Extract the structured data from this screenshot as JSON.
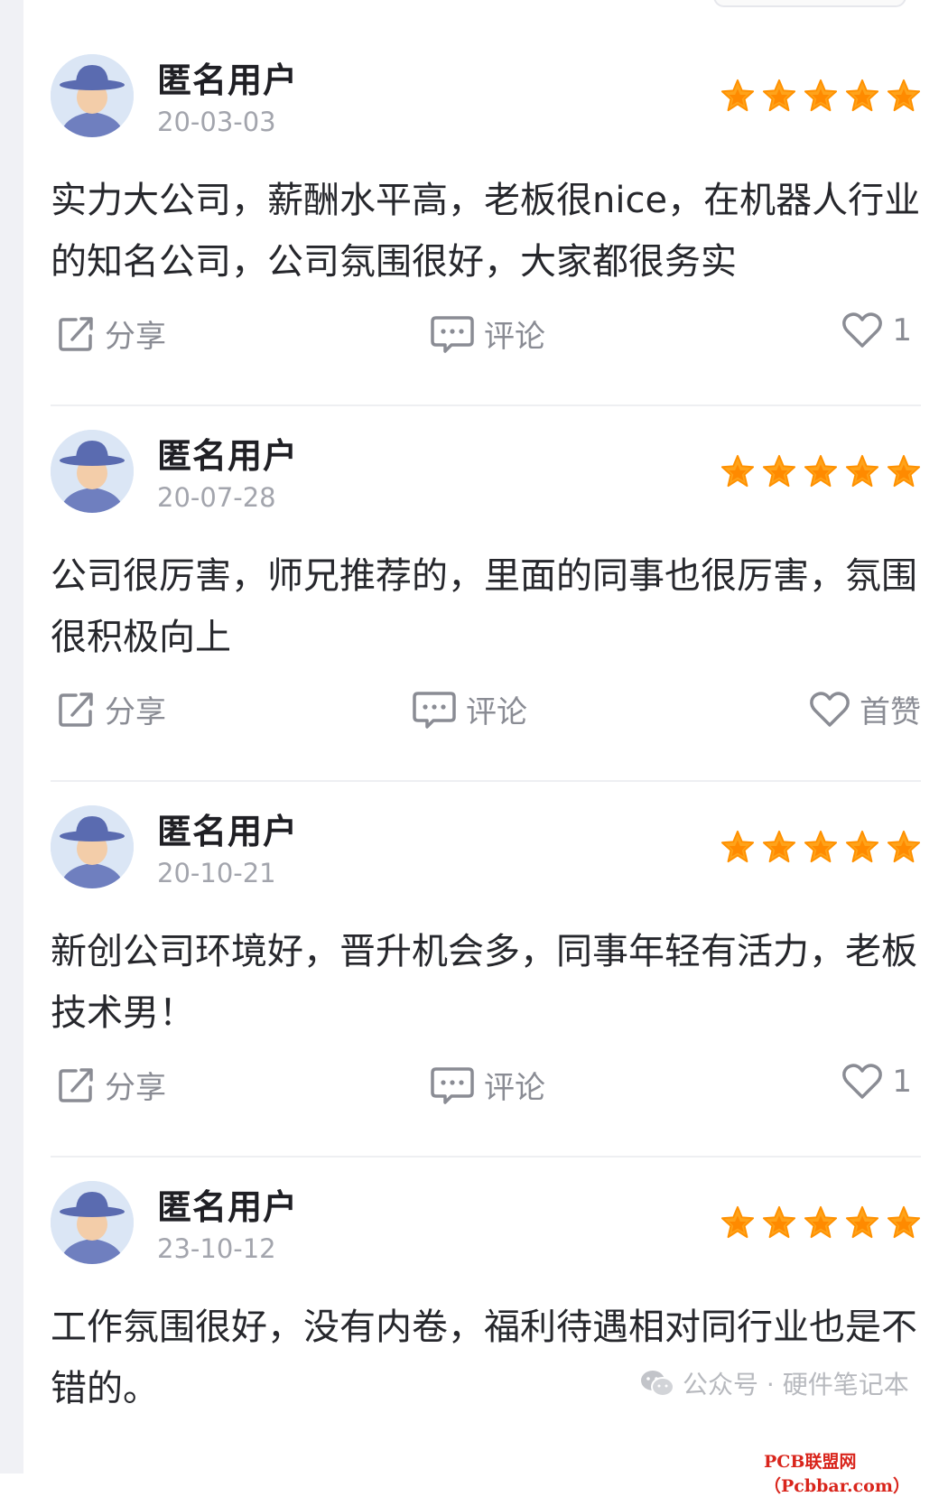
{
  "reviews": [
    {
      "user": "匿名用户",
      "date": "20-03-03",
      "rating": 5,
      "text": "实力大公司，薪酬水平高，老板很nice，在机器人行业的知名公司，公司氛围很好，大家都很务实",
      "share_label": "分享",
      "comment_label": "评论",
      "like_label": "1"
    },
    {
      "user": "匿名用户",
      "date": "20-07-28",
      "rating": 5,
      "text": "公司很厉害，师兄推荐的，里面的同事也很厉害，氛围很积极向上",
      "share_label": "分享",
      "comment_label": "评论",
      "like_label": "首赞"
    },
    {
      "user": "匿名用户",
      "date": "20-10-21",
      "rating": 5,
      "text": "新创公司环境好，晋升机会多，同事年轻有活力，老板技术男！",
      "share_label": "分享",
      "comment_label": "评论",
      "like_label": "1"
    },
    {
      "user": "匿名用户",
      "date": "23-10-12",
      "rating": 5,
      "text": "工作氛围很好，没有内卷，福利待遇相对同行业也是不错的。"
    }
  ],
  "watermark": {
    "text": "公众号 · 硬件笔记本",
    "icon": "wechat-icon",
    "site": "PCB联盟网（Pcbbar.com）"
  },
  "colors": {
    "star": "#ffa31a",
    "star_inner": "#ff8a00",
    "icon": "#8a8c94",
    "divider": "#eeeff2"
  }
}
